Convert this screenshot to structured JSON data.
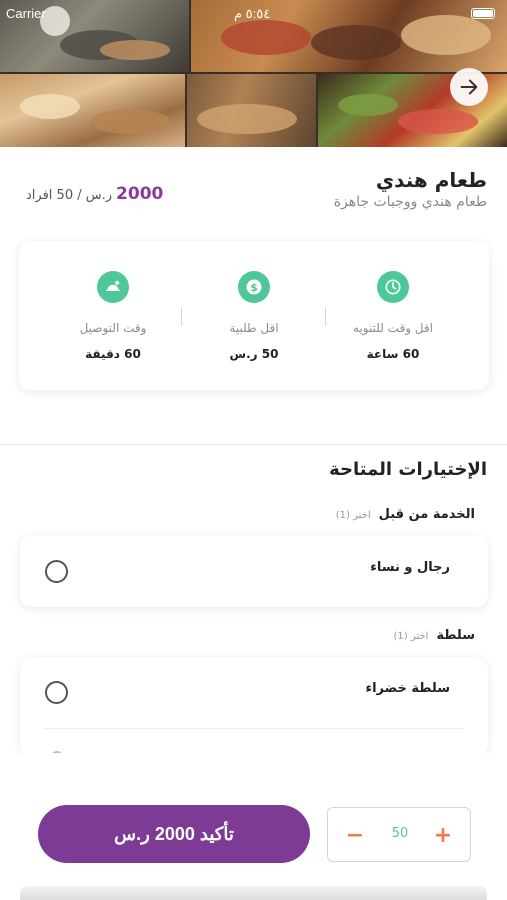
{
  "status_bar": {
    "carrier": "Carrier",
    "time": "٥:٥٤ م"
  },
  "hero": {
    "next_icon": "arrow-right-icon"
  },
  "product": {
    "title": "طعام هندي",
    "subtitle": "طعام هندي ووجبات جاهزة",
    "price_value": "2000",
    "price_suffix": "ر.س / 50 افراد"
  },
  "info": [
    {
      "icon": "clock-icon",
      "label": "اقل وقت للتنويه",
      "value": "60 ساعة"
    },
    {
      "icon": "dollar-icon",
      "label": "اقل طلبية",
      "value": "50 ر.س"
    },
    {
      "icon": "delivery-icon",
      "label": "وقت التوصيل",
      "value": "60 دقيقة"
    }
  ],
  "options": {
    "section_title": "الإختيارات المتاحة",
    "groups": [
      {
        "name": "الخدمة من قبل",
        "hint": "اختر (1)",
        "items": [
          {
            "label": "رجال و نساء"
          }
        ]
      },
      {
        "name": "سلطة",
        "hint": "اختر (1)",
        "items": [
          {
            "label": "سلطة خضراء"
          }
        ]
      }
    ]
  },
  "footer": {
    "confirm_label": "تأكيد 2000 ر.س",
    "quantity": "50",
    "minus": "−",
    "plus": "+"
  },
  "colors": {
    "accent": "#7d3b96",
    "price": "#8e3a9b",
    "green": "#4ec79a",
    "stepper": "#f07a4e"
  }
}
